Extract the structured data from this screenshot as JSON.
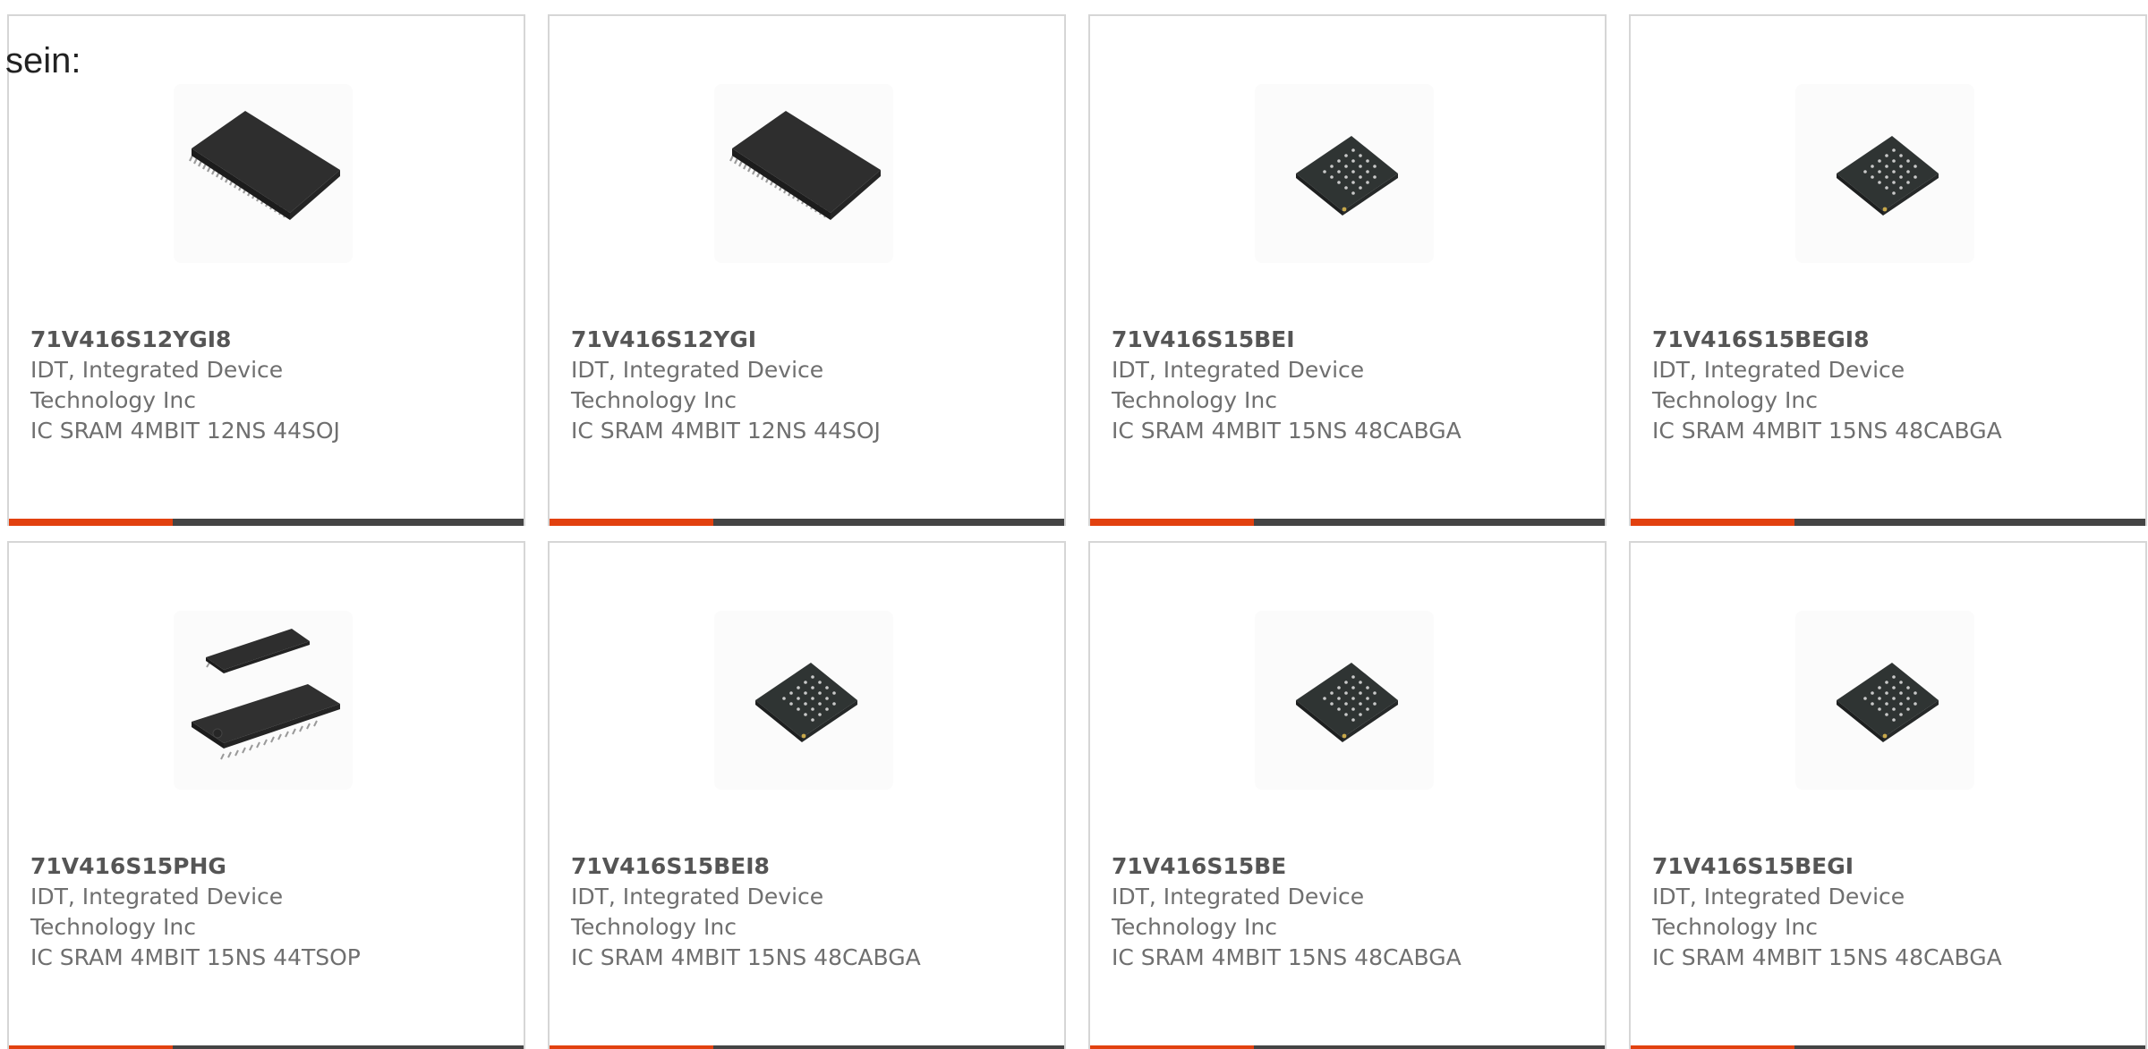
{
  "intro_text": "sein:",
  "colors": {
    "accent": "#e2410f",
    "bar": "#444444",
    "border": "#d6d6d6",
    "title": "#555555",
    "text": "#6f6f6f"
  },
  "products": [
    {
      "part_number": "71V416S12YGI8",
      "manufacturer_line1": "IDT, Integrated Device",
      "manufacturer_line2": "Technology Inc",
      "description": "IC SRAM 4MBIT 12NS 44SOJ",
      "image_icon": "soj-chip-icon"
    },
    {
      "part_number": "71V416S12YGI",
      "manufacturer_line1": "IDT, Integrated Device",
      "manufacturer_line2": "Technology Inc",
      "description": "IC SRAM 4MBIT 12NS 44SOJ",
      "image_icon": "soj-chip-icon"
    },
    {
      "part_number": "71V416S15BEI",
      "manufacturer_line1": "IDT, Integrated Device",
      "manufacturer_line2": "Technology Inc",
      "description": "IC SRAM 4MBIT 15NS 48CABGA",
      "image_icon": "bga-chip-icon"
    },
    {
      "part_number": "71V416S15BEGI8",
      "manufacturer_line1": "IDT, Integrated Device",
      "manufacturer_line2": "Technology Inc",
      "description": "IC SRAM 4MBIT 15NS 48CABGA",
      "image_icon": "bga-chip-icon"
    },
    {
      "part_number": "71V416S15PHG",
      "manufacturer_line1": "IDT, Integrated Device",
      "manufacturer_line2": "Technology Inc",
      "description": "IC SRAM 4MBIT 15NS 44TSOP",
      "image_icon": "tsop-chip-icon"
    },
    {
      "part_number": "71V416S15BEI8",
      "manufacturer_line1": "IDT, Integrated Device",
      "manufacturer_line2": "Technology Inc",
      "description": "IC SRAM 4MBIT 15NS 48CABGA",
      "image_icon": "bga-chip-icon"
    },
    {
      "part_number": "71V416S15BE",
      "manufacturer_line1": "IDT, Integrated Device",
      "manufacturer_line2": "Technology Inc",
      "description": "IC SRAM 4MBIT 15NS 48CABGA",
      "image_icon": "bga-chip-icon"
    },
    {
      "part_number": "71V416S15BEGI",
      "manufacturer_line1": "IDT, Integrated Device",
      "manufacturer_line2": "Technology Inc",
      "description": "IC SRAM 4MBIT 15NS 48CABGA",
      "image_icon": "bga-chip-icon"
    }
  ]
}
